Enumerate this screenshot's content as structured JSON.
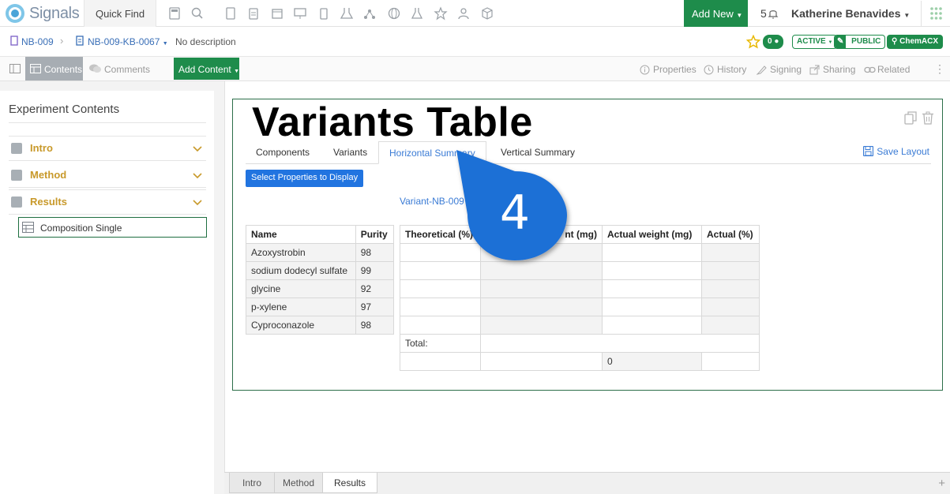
{
  "app": {
    "name": "Signals",
    "quick_find": "Quick Find"
  },
  "header": {
    "add_new": "Add New",
    "notification_count": "5",
    "user_name": "Katherine Benavides"
  },
  "breadcrumb": {
    "notebook": "NB-009",
    "experiment": "NB-009-KB-0067",
    "description": "No description"
  },
  "status": {
    "comments_count": "0",
    "state": "ACTIVE",
    "visibility": "PUBLIC",
    "chemacx": "ChemACX"
  },
  "toolbar": {
    "contents": "Contents",
    "comments": "Comments",
    "add_content": "Add Content",
    "properties": "Properties",
    "history": "History",
    "signing": "Signing",
    "sharing": "Sharing",
    "related": "Related"
  },
  "sidebar": {
    "title": "Experiment Contents",
    "sections": [
      {
        "label": "Intro"
      },
      {
        "label": "Method"
      },
      {
        "label": "Results"
      }
    ],
    "selected_item": "Composition Single"
  },
  "card": {
    "title": "Variants Table",
    "tabs": [
      "Components",
      "Variants",
      "Horizontal Summary",
      "Vertical Summary"
    ],
    "active_tab": "Horizontal Summary",
    "save_layout": "Save Layout",
    "select_properties": "Select Properties to Display",
    "variant_link": "Variant-NB-009"
  },
  "components_table": {
    "headers": [
      "Name",
      "Purity"
    ],
    "rows": [
      [
        "Azoxystrobin",
        "98"
      ],
      [
        "sodium dodecyl sulfate",
        "99"
      ],
      [
        "glycine",
        "92"
      ],
      [
        "p-xylene",
        "97"
      ],
      [
        "Cyproconazole",
        "98"
      ]
    ]
  },
  "variant_table": {
    "headers": [
      "Theoretical (%)",
      "nt (mg)",
      "Actual weight (mg)",
      "Actual (%)"
    ],
    "total_label": "Total:",
    "total_value": "0"
  },
  "callout": {
    "number": "4",
    "color": "#1f6fd6"
  },
  "bottom_tabs": [
    "Intro",
    "Method",
    "Results"
  ],
  "bottom_active": "Results",
  "colors": {
    "brand_green": "#1e8c4b",
    "link_blue": "#3a7bd5",
    "section_gold": "#c8992a"
  }
}
